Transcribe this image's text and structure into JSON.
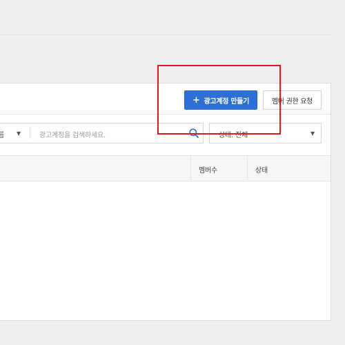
{
  "toolbar": {
    "create_label": "광고계정 만들기",
    "create_icon": "plus-icon",
    "request_label": "멤버 권한 요청"
  },
  "search": {
    "type_label_partial": "름",
    "placeholder": "광고계정을 검색하세요."
  },
  "status_filter": {
    "value": "상태: 전체"
  },
  "table": {
    "columns": [
      "멤버수",
      "상태"
    ]
  },
  "colors": {
    "primary": "#2d6fd6",
    "highlight": "#e3141b"
  }
}
